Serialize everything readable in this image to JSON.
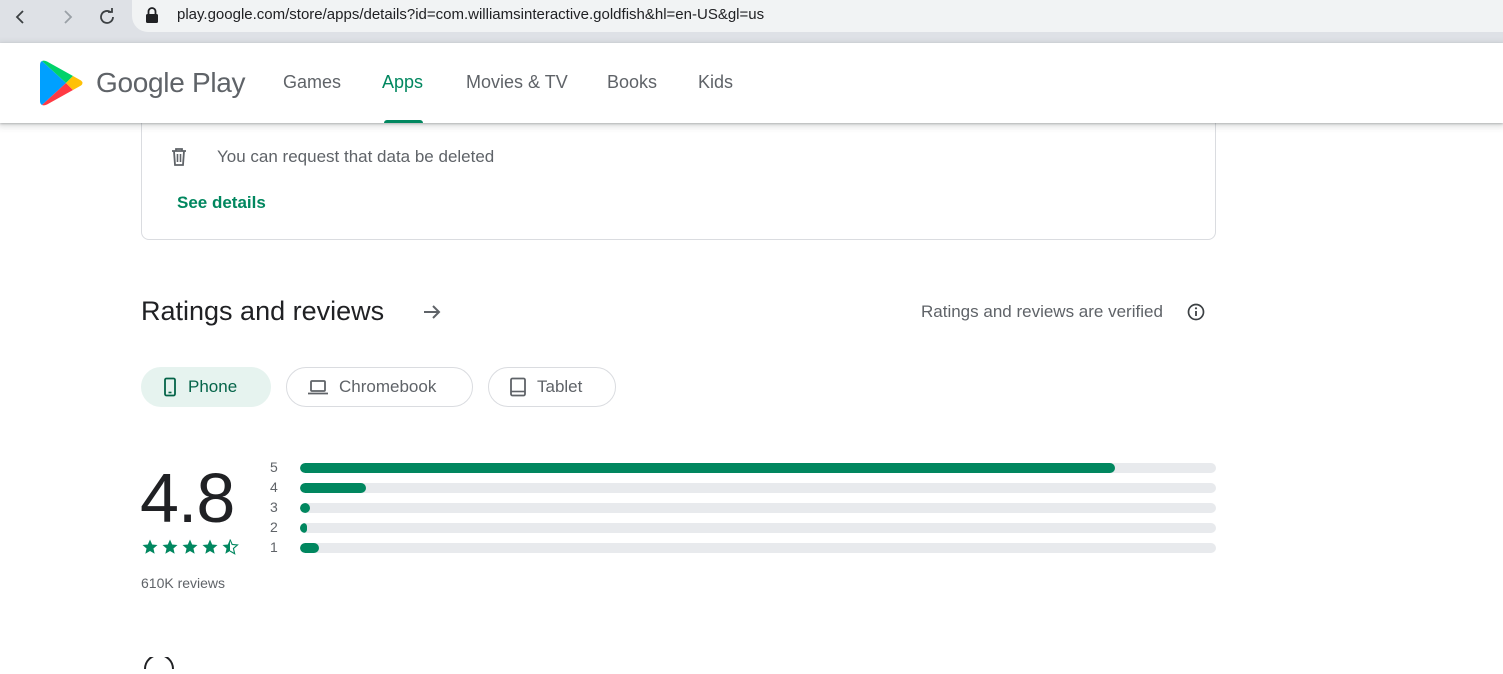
{
  "browser": {
    "url": "play.google.com/store/apps/details?id=com.williamsinteractive.goldfish&hl=en-US&gl=us"
  },
  "header": {
    "brand": "Google Play",
    "tabs": [
      {
        "label": "Games",
        "active": false
      },
      {
        "label": "Apps",
        "active": true
      },
      {
        "label": "Movies & TV",
        "active": false
      },
      {
        "label": "Books",
        "active": false
      },
      {
        "label": "Kids",
        "active": false
      }
    ]
  },
  "data_safety": {
    "delete_text": "You can request that data be deleted",
    "see_details": "See details"
  },
  "ratings": {
    "title": "Ratings and reviews",
    "verified_text": "Ratings and reviews are verified",
    "device_chips": [
      {
        "label": "Phone",
        "icon": "phone-icon",
        "active": true
      },
      {
        "label": "Chromebook",
        "icon": "laptop-icon",
        "active": false
      },
      {
        "label": "Tablet",
        "icon": "tablet-icon",
        "active": false
      }
    ],
    "score": "4.8",
    "stars_value": 4.5,
    "reviews_count": "610K reviews",
    "distribution": [
      {
        "label": "5",
        "fraction": 0.89
      },
      {
        "label": "4",
        "fraction": 0.072
      },
      {
        "label": "3",
        "fraction": 0.011
      },
      {
        "label": "2",
        "fraction": 0.006
      },
      {
        "label": "1",
        "fraction": 0.021
      }
    ]
  },
  "colors": {
    "accent": "#01875f",
    "track": "#e8eaed",
    "chip_active_bg": "#e6f3ef"
  }
}
